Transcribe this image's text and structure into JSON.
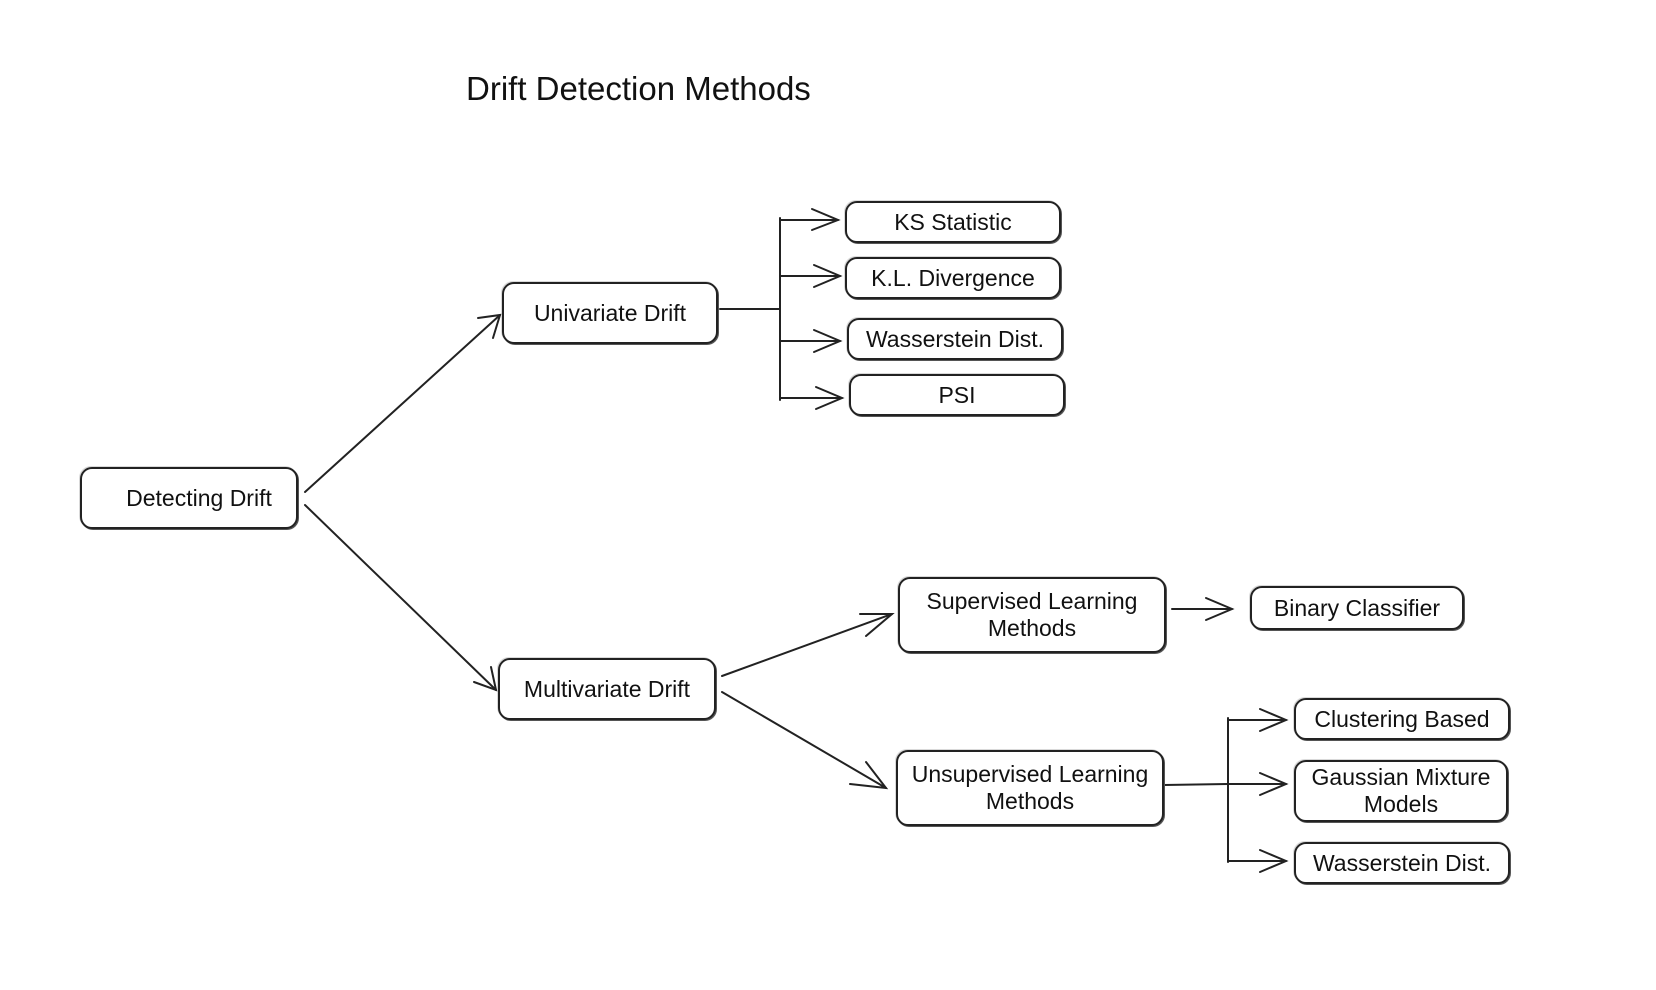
{
  "title": "Drift Detection Methods",
  "nodes": {
    "root": "Detecting Drift",
    "univariate": "Univariate Drift",
    "multivariate": "Multivariate Drift",
    "ks": "KS Statistic",
    "kl": "K.L. Divergence",
    "wasserstein_uni": "Wasserstein Dist.",
    "psi": "PSI",
    "supervised": "Supervised Learning\nMethods",
    "unsupervised": "Unsupervised Learning\nMethods",
    "binary": "Binary Classifier",
    "clustering": "Clustering Based",
    "gmm": "Gaussian Mixture\nModels",
    "wasserstein_multi": "Wasserstein Dist."
  },
  "edges": [
    [
      "root",
      "univariate"
    ],
    [
      "root",
      "multivariate"
    ],
    [
      "univariate",
      "ks"
    ],
    [
      "univariate",
      "kl"
    ],
    [
      "univariate",
      "wasserstein_uni"
    ],
    [
      "univariate",
      "psi"
    ],
    [
      "multivariate",
      "supervised"
    ],
    [
      "multivariate",
      "unsupervised"
    ],
    [
      "supervised",
      "binary"
    ],
    [
      "unsupervised",
      "clustering"
    ],
    [
      "unsupervised",
      "gmm"
    ],
    [
      "unsupervised",
      "wasserstein_multi"
    ]
  ]
}
